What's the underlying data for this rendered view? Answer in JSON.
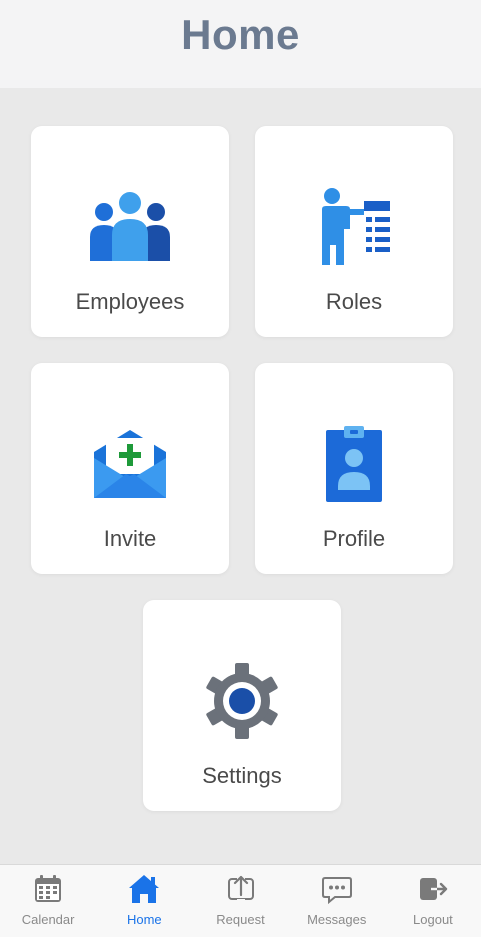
{
  "header": {
    "title": "Home"
  },
  "tiles": [
    {
      "label": "Employees",
      "icon": "people-group-icon"
    },
    {
      "label": "Roles",
      "icon": "person-list-icon"
    },
    {
      "label": "Invite",
      "icon": "envelope-add-icon"
    },
    {
      "label": "Profile",
      "icon": "id-badge-icon"
    },
    {
      "label": "Settings",
      "icon": "gear-icon"
    }
  ],
  "tabbar": {
    "active": "Home",
    "items": [
      {
        "label": "Calendar",
        "icon": "calendar-icon"
      },
      {
        "label": "Home",
        "icon": "home-icon"
      },
      {
        "label": "Request",
        "icon": "upload-icon"
      },
      {
        "label": "Messages",
        "icon": "chat-bubble-icon"
      },
      {
        "label": "Logout",
        "icon": "logout-icon"
      }
    ]
  },
  "colors": {
    "accent": "#1a73e8",
    "header_text": "#6b7a90",
    "tab_inactive": "#8a8a8a",
    "background": "#e9e9e9"
  }
}
